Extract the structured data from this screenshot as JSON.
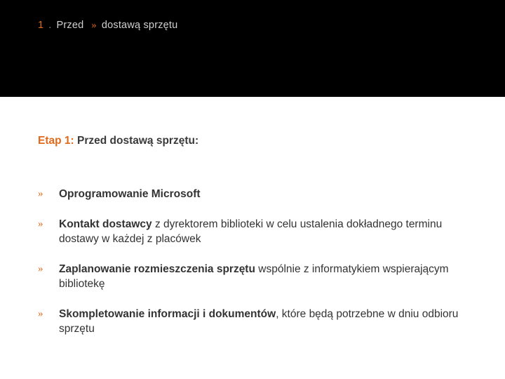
{
  "header": {
    "bc_number": "1",
    "bc_sep": ".",
    "bc_first": "Przed",
    "bc_arrow": "»",
    "bc_rest": "dostawą sprzętu"
  },
  "section_title": {
    "accent": "Etap 1:",
    "rest": " Przed dostawą sprzętu:"
  },
  "bullet": "»",
  "items": [
    {
      "bold": "Oprogramowanie Microsoft",
      "rest": ""
    },
    {
      "bold": "Kontakt dostawcy",
      "rest": " z dyrektorem biblioteki w celu ustalenia dokładnego terminu dostawy w każdej z placówek"
    },
    {
      "bold": "Zaplanowanie rozmieszczenia sprzętu",
      "rest": " wspólnie z informatykiem wspierającym bibliotekę"
    },
    {
      "bold": "Skompletowanie informacji i dokumentów",
      "rest": ", które będą potrzebne w dniu odbioru sprzętu"
    }
  ]
}
